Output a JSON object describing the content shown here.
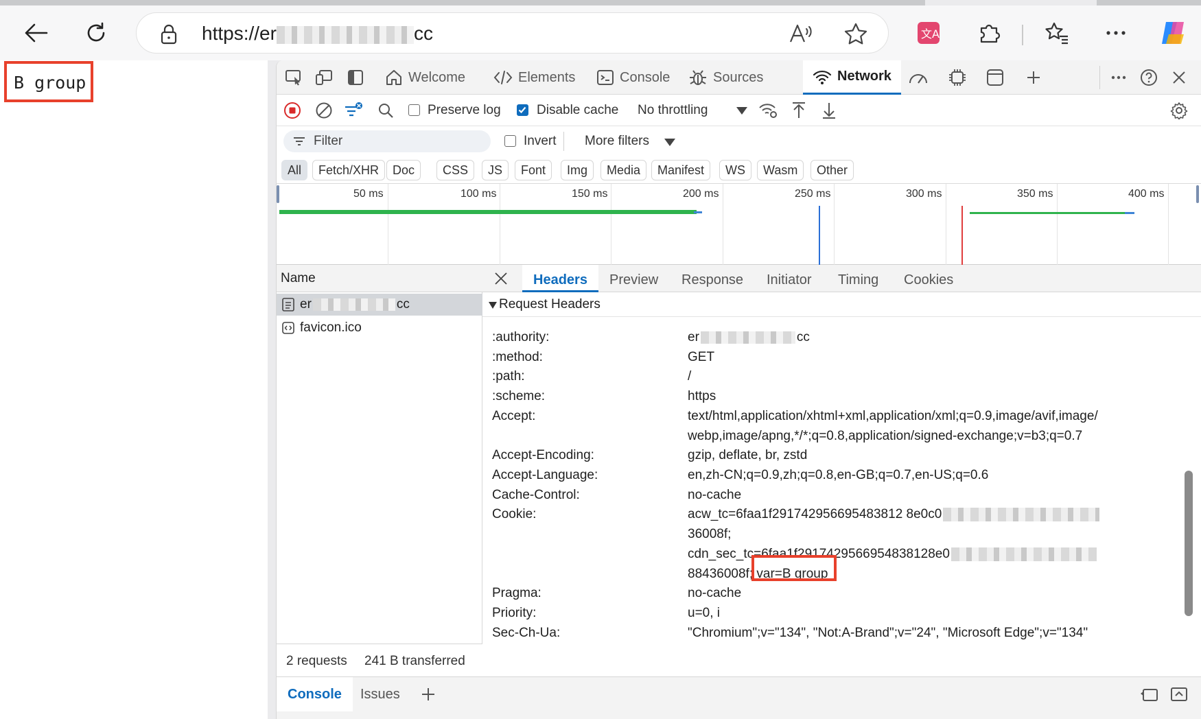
{
  "browser": {
    "url_prefix": "https://er",
    "url_suffix": "cc",
    "icons": [
      "back-icon",
      "refresh-icon",
      "lock-icon",
      "read-aloud-icon",
      "favorite-icon",
      "translate-icon",
      "extensions-icon",
      "favorites-icon",
      "more-icon",
      "copilot-icon"
    ]
  },
  "page": {
    "text": "B group"
  },
  "devtools": {
    "tabs": [
      "Welcome",
      "Elements",
      "Console",
      "Sources",
      "Network"
    ],
    "active_tab": "Network",
    "toolbar": {
      "preserve_log": "Preserve log",
      "preserve_log_checked": false,
      "disable_cache": "Disable cache",
      "disable_cache_checked": true,
      "throttling": "No throttling"
    },
    "filter": {
      "placeholder": "Filter",
      "invert": "Invert",
      "more_filters": "More filters"
    },
    "types": [
      "All",
      "Fetch/XHR",
      "Doc",
      "CSS",
      "JS",
      "Font",
      "Img",
      "Media",
      "Manifest",
      "WS",
      "Wasm",
      "Other"
    ],
    "timeline_ticks": [
      "50 ms",
      "100 ms",
      "150 ms",
      "200 ms",
      "250 ms",
      "300 ms",
      "350 ms",
      "400 ms"
    ],
    "requests": {
      "header": "Name",
      "items": [
        {
          "prefix": "er",
          "suffix": "cc"
        },
        {
          "name": "favicon.ico"
        }
      ],
      "count": "2 requests",
      "transferred": "241 B transferred"
    },
    "details": {
      "tabs": [
        "Headers",
        "Preview",
        "Response",
        "Initiator",
        "Timing",
        "Cookies"
      ],
      "active_tab": "Headers",
      "section": "Request Headers",
      "headers": [
        {
          "k": ":authority:",
          "v": "er",
          "v_end": "cc"
        },
        {
          "k": ":method:",
          "v": "GET"
        },
        {
          "k": ":path:",
          "v": "/"
        },
        {
          "k": ":scheme:",
          "v": "https"
        },
        {
          "k": "Accept:",
          "v": "text/html,application/xhtml+xml,application/xml;q=0.9,image/avif,image/",
          "v2": "webp,image/apng,*/*;q=0.8,application/signed-exchange;v=b3;q=0.7"
        },
        {
          "k": "Accept-Encoding:",
          "v": "gzip, deflate, br, zstd"
        },
        {
          "k": "Accept-Language:",
          "v": "en,zh-CN;q=0.9,zh;q=0.8,en-GB;q=0.7,en-US;q=0.6"
        },
        {
          "k": "Cache-Control:",
          "v": "no-cache"
        },
        {
          "k": "Cookie:",
          "v": "acw_tc=6faa1f291742956695483812 8e0c0",
          "v2": "36008f;",
          "v3": "cdn_sec_tc=6faa1f2917429566954838128e0",
          "v4": "88436008f;",
          "v4_highlight": "var=B group"
        },
        {
          "k": "Pragma:",
          "v": "no-cache"
        },
        {
          "k": "Priority:",
          "v": "u=0, i"
        },
        {
          "k": "Sec-Ch-Ua:",
          "v": "\"Chromium\";v=\"134\", \"Not:A-Brand\";v=\"24\", \"Microsoft Edge\";v=\"134\""
        }
      ]
    },
    "drawer": {
      "tabs": [
        "Console",
        "Issues"
      ],
      "active": "Console"
    }
  },
  "colors": {
    "accent": "#0f6cbd",
    "highlight": "#e8412c",
    "timeline_green": "#2fb34d"
  }
}
